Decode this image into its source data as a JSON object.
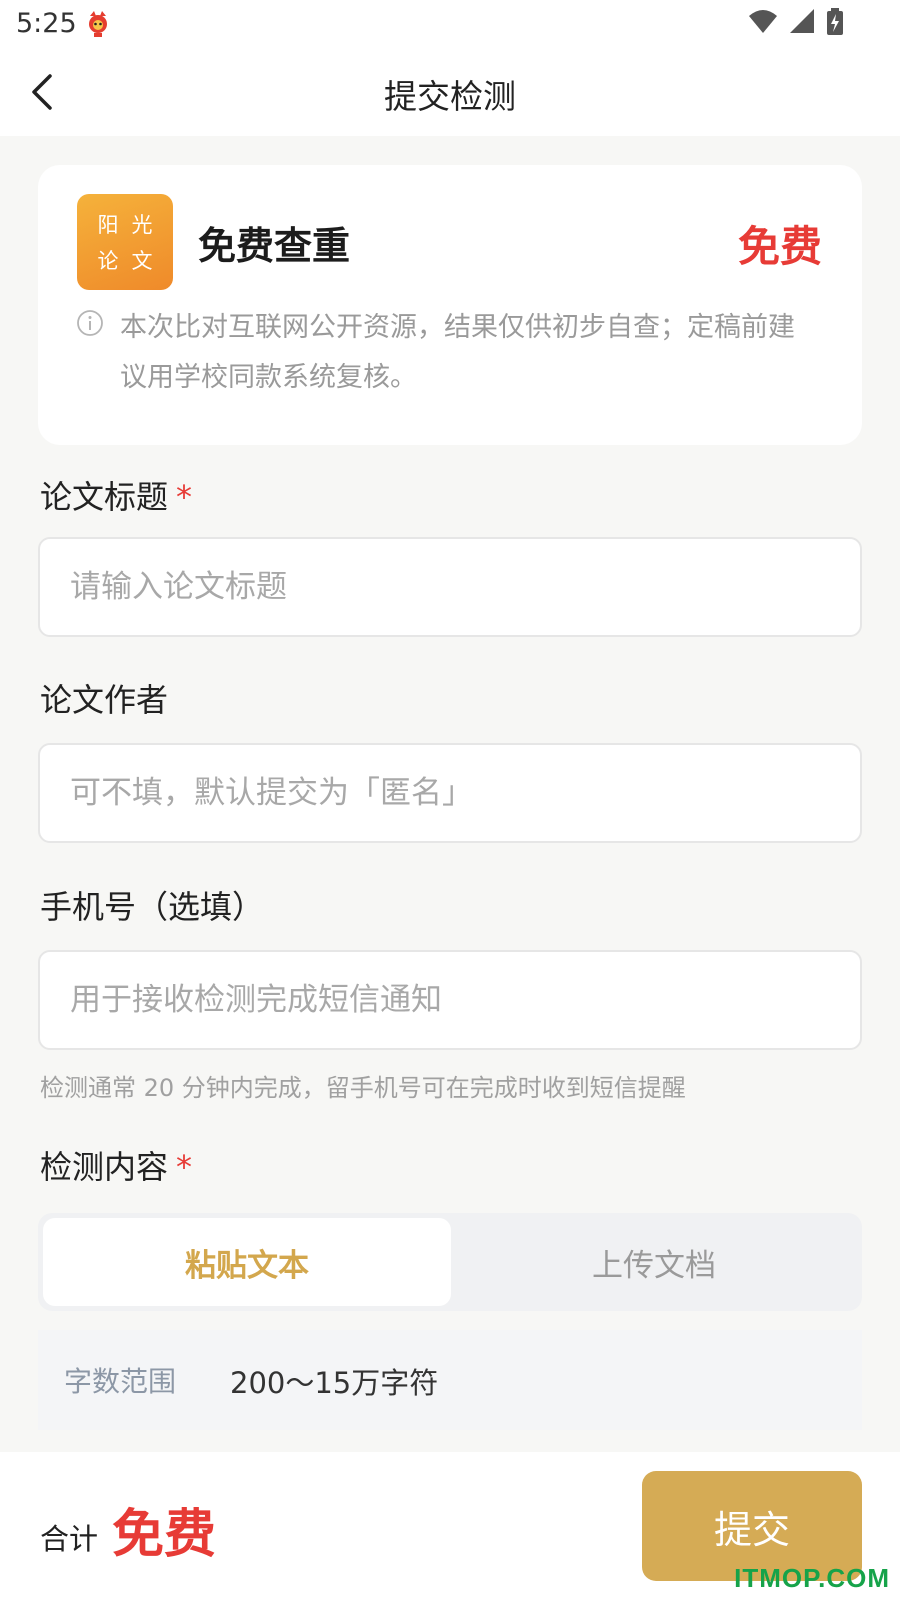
{
  "status_bar": {
    "time": "5:25"
  },
  "header": {
    "title": "提交检测"
  },
  "product": {
    "logo_chars": [
      "阳",
      "光",
      "论",
      "文"
    ],
    "name": "免费查重",
    "price": "免费",
    "notice": "本次比对互联网公开资源，结果仅供初步自查；定稿前建议用学校同款系统复核。"
  },
  "form": {
    "title": {
      "label": "论文标题",
      "required_mark": "*",
      "placeholder": "请输入论文标题",
      "value": ""
    },
    "author": {
      "label": "论文作者",
      "placeholder": "可不填，默认提交为「匿名」",
      "value": ""
    },
    "phone": {
      "label": "手机号（选填）",
      "placeholder": "用于接收检测完成短信通知",
      "value": "",
      "hint": "检测通常 20 分钟内完成，留手机号可在完成时收到短信提醒"
    },
    "content": {
      "label": "检测内容",
      "required_mark": "*",
      "tabs": [
        {
          "label": "粘贴文本",
          "active": true
        },
        {
          "label": "上传文档",
          "active": false
        }
      ],
      "range_label": "字数范围",
      "range_value": "200～15万字符"
    }
  },
  "footer": {
    "total_label": "合计",
    "total_value": "免费",
    "submit_label": "提交"
  },
  "watermark": "ITMOP.COM",
  "colors": {
    "accent_gold": "#d5ab55",
    "price_red": "#e73b36",
    "logo_orange": "#f19a30"
  }
}
